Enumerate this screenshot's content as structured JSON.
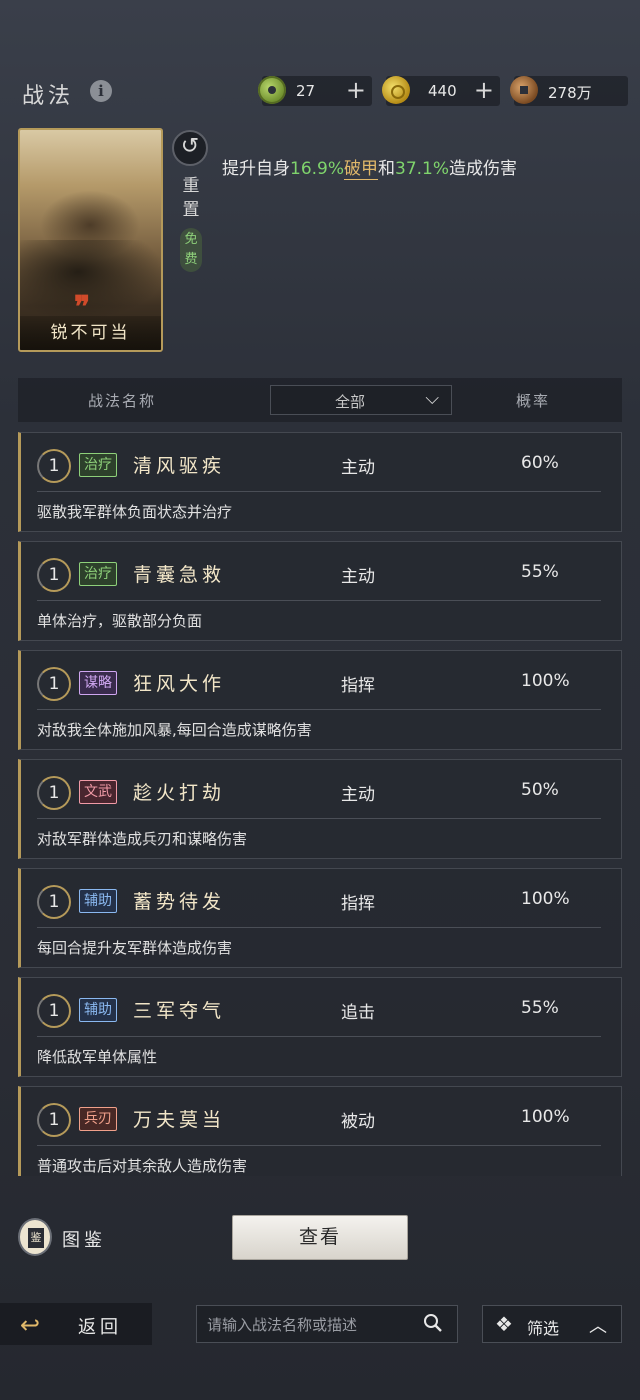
{
  "header": {
    "title": "战法",
    "resources": [
      {
        "icon": "jade-coin-icon",
        "value": "27"
      },
      {
        "icon": "gold-coin-icon",
        "value": "440"
      },
      {
        "icon": "copper-coin-icon",
        "value": "278万"
      }
    ]
  },
  "selected_skill": {
    "name": "锐不可当",
    "reset_label": "重置",
    "free_label": "免费",
    "desc_prefix": "提升自身",
    "value1": "16.9%",
    "stat1": "破甲",
    "conj": "和",
    "value2": "37.1%",
    "desc_suffix": "造成伤害"
  },
  "table_header": {
    "name_col": "战法名称",
    "filter_label": "全部",
    "rate_col": "概率"
  },
  "skills": [
    {
      "level": "1",
      "tag": "治疗",
      "tag_class": "tag-heal",
      "name": "清风驱疾",
      "type": "主动",
      "rate": "60%",
      "desc": "驱散我军群体负面状态并治疗"
    },
    {
      "level": "1",
      "tag": "治疗",
      "tag_class": "tag-heal",
      "name": "青囊急救",
      "type": "主动",
      "rate": "55%",
      "desc": "单体治疗，驱散部分负面"
    },
    {
      "level": "1",
      "tag": "谋略",
      "tag_class": "tag-plot",
      "name": "狂风大作",
      "type": "指挥",
      "rate": "100%",
      "desc": "对敌我全体施加风暴,每回合造成谋略伤害"
    },
    {
      "level": "1",
      "tag": "文武",
      "tag_class": "tag-mix",
      "name": "趁火打劫",
      "type": "主动",
      "rate": "50%",
      "desc": "对敌军群体造成兵刃和谋略伤害"
    },
    {
      "level": "1",
      "tag": "辅助",
      "tag_class": "tag-aux",
      "name": "蓄势待发",
      "type": "指挥",
      "rate": "100%",
      "desc": "每回合提升友军群体造成伤害"
    },
    {
      "level": "1",
      "tag": "辅助",
      "tag_class": "tag-aux",
      "name": "三军夺气",
      "type": "追击",
      "rate": "55%",
      "desc": "降低敌军单体属性"
    },
    {
      "level": "1",
      "tag": "兵刃",
      "tag_class": "tag-troop",
      "name": "万夫莫当",
      "type": "被动",
      "rate": "100%",
      "desc": "普通攻击后对其余敌人造成伤害"
    }
  ],
  "footer": {
    "codex_label": "图鉴",
    "codex_icon_char": "鉴",
    "view_button": "查看",
    "back_label": "返回",
    "search_placeholder": "请输入战法名称或描述",
    "filter_label": "筛选"
  },
  "colors": {
    "accent_gold": "#b59a5a",
    "highlight_green": "#7fd46c",
    "highlight_orange": "#e0b86a"
  }
}
